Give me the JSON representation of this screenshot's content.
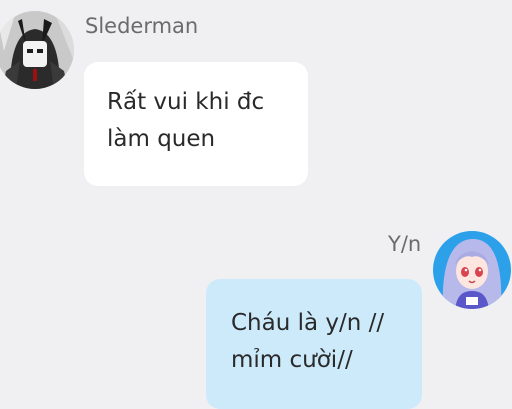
{
  "conversation": {
    "messages": [
      {
        "sender": "Slederman",
        "side": "left",
        "avatar_icon": "dark-masked-character-avatar",
        "bubble_color": "#ffffff",
        "lines": [
          "Rất vui khi đc",
          "làm quen"
        ]
      },
      {
        "sender": "Y/n",
        "side": "right",
        "avatar_icon": "blue-haired-anime-girl-avatar",
        "bubble_color": "#cdeafb",
        "lines": [
          "Cháu là y/n //",
          "mỉm cười//"
        ]
      }
    ]
  },
  "colors": {
    "background": "#f0f0f2",
    "name_text": "#6b6b6b",
    "message_text": "#2a2a2a"
  }
}
